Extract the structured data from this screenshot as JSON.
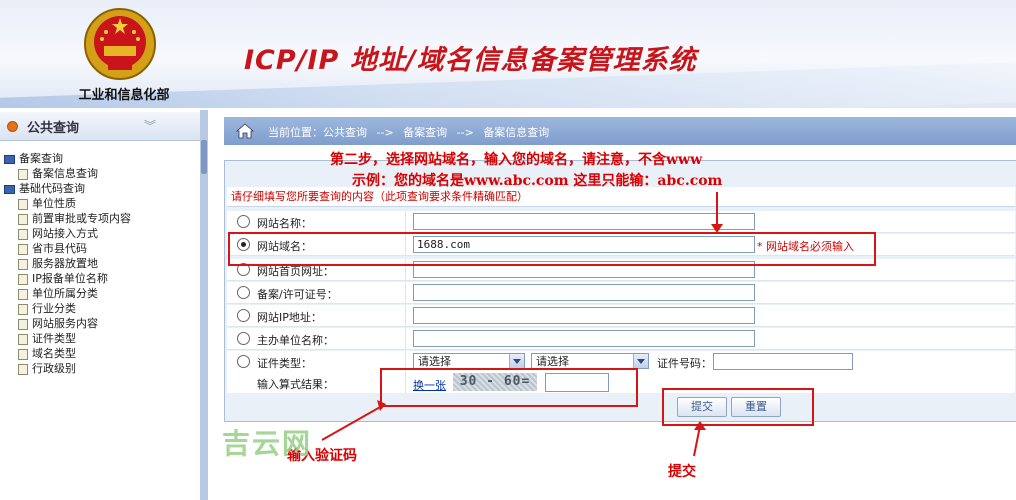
{
  "header": {
    "system_title": "ICP/IP 地址/域名信息备案管理系统",
    "ministry": "工业和信息化部"
  },
  "sidebar": {
    "title": "公共查询",
    "tree": [
      {
        "label": "备案查询",
        "level": 0,
        "icon": "folder-icon"
      },
      {
        "label": "备案信息查询",
        "level": 1,
        "icon": "document-icon"
      },
      {
        "label": "基础代码查询",
        "level": 0,
        "icon": "folder-icon"
      },
      {
        "label": "单位性质",
        "level": 1,
        "icon": "document-icon"
      },
      {
        "label": "前置审批或专项内容",
        "level": 1,
        "icon": "document-icon"
      },
      {
        "label": "网站接入方式",
        "level": 1,
        "icon": "document-icon"
      },
      {
        "label": "省市县代码",
        "level": 1,
        "icon": "document-icon"
      },
      {
        "label": "服务器放置地",
        "level": 1,
        "icon": "document-icon"
      },
      {
        "label": "IP报备单位名称",
        "level": 1,
        "icon": "document-icon"
      },
      {
        "label": "单位所属分类",
        "level": 1,
        "icon": "document-icon"
      },
      {
        "label": "行业分类",
        "level": 1,
        "icon": "document-icon"
      },
      {
        "label": "网站服务内容",
        "level": 1,
        "icon": "document-icon"
      },
      {
        "label": "证件类型",
        "level": 1,
        "icon": "document-icon"
      },
      {
        "label": "域名类型",
        "level": 1,
        "icon": "document-icon"
      },
      {
        "label": "行政级别",
        "level": 1,
        "icon": "document-icon"
      }
    ]
  },
  "breadcrumb": {
    "prefix": "当前位置：公共查询",
    "sep1": "-->",
    "item2": "备案查询",
    "sep2": "-->",
    "item3": "备案信息查询"
  },
  "annotations": {
    "step2": "第二步，选择网站域名，输入您的域名，请注意，不含www",
    "example": "示例：您的域名是www.abc.com 这里只能输：abc.com",
    "captcha": "输入验证码",
    "submit": "提交"
  },
  "form": {
    "instruction": "请仔细填写您所要查询的内容（此项查询要求条件精确匹配）",
    "rows": {
      "site_name": {
        "label": "网站名称：",
        "value": "",
        "selected": false
      },
      "site_domain": {
        "label": "网站域名：",
        "value": "1688.com",
        "selected": true,
        "note": "* 网站域名必须输入"
      },
      "homepage": {
        "label": "网站首页网址：",
        "value": "",
        "selected": false
      },
      "license": {
        "label": "备案/许可证号：",
        "value": "",
        "selected": false
      },
      "site_ip": {
        "label": "网站IP地址：",
        "value": "",
        "selected": false
      },
      "sponsor": {
        "label": "主办单位名称：",
        "value": "",
        "selected": false
      },
      "cert_type": {
        "label": "证件类型：",
        "select1": "请选择",
        "select2": "请选择",
        "cert_no_label": "证件号码：",
        "cert_no": "",
        "selected": false
      }
    },
    "captcha": {
      "label": "输入算式结果：",
      "refresh_link": "换一张",
      "image_text": "30 - 60=",
      "value": ""
    },
    "buttons": {
      "submit": "提交",
      "reset": "重置"
    }
  },
  "watermark": "吉云网",
  "colors": {
    "annotation_red": "#d90000",
    "title_red": "#c8141a",
    "breadcrumb_blue": "#8aa6d3"
  }
}
